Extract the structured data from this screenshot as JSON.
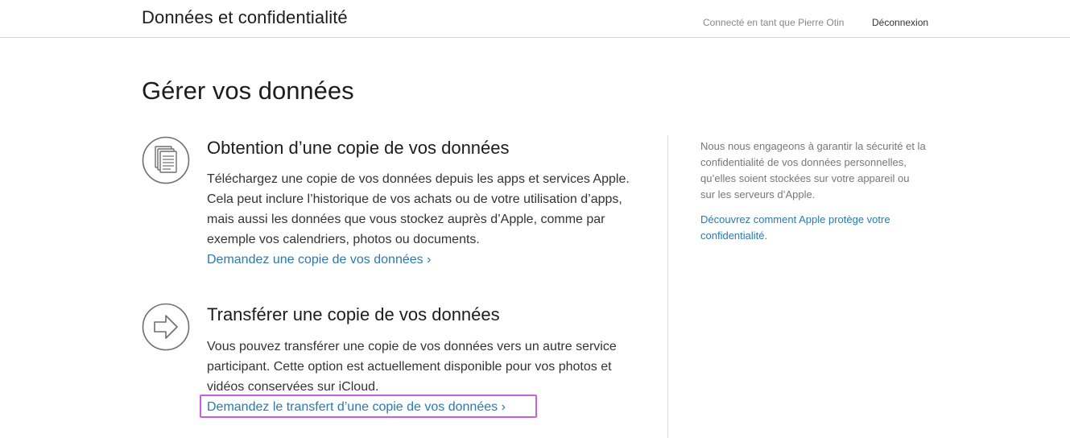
{
  "header": {
    "site_title": "Données et confidentialité",
    "signed_in_as": "Connecté en tant que Pierre Otin",
    "logout_label": "Déconnexion"
  },
  "main": {
    "title": "Gérer vos données",
    "sections": [
      {
        "icon": "document-copy-icon",
        "heading": "Obtention d’une copie de vos données",
        "body": "Téléchargez une copie de vos données depuis les apps et services Apple. Cela peut inclure l’historique de vos achats ou de votre utilisation d’apps, mais aussi les données que vous stockez auprès d’Apple, comme par exemple vos calendriers, photos ou documents.",
        "link": "Demandez une copie de vos données ›"
      },
      {
        "icon": "transfer-arrow-icon",
        "heading": "Transférer une copie de vos données",
        "body": "Vous pouvez transférer une copie de vos données vers un autre service participant. Cette option est actuellement disponible pour vos photos et vidéos conservées sur iCloud.",
        "link": "Demandez le transfert d’une copie de vos données ›",
        "highlighted": true
      }
    ]
  },
  "aside": {
    "text": "Nous nous engageons à garantir la sécurité et la confidentialité de vos données personnelles, qu’elles soient stockées sur votre appareil ou sur les serveurs d’Apple.",
    "link": "Découvrez comment Apple protège votre confidentialité."
  },
  "colors": {
    "link": "#2a7ab0",
    "highlight": "#c95ee6",
    "icon_stroke": "#6e6e73"
  }
}
